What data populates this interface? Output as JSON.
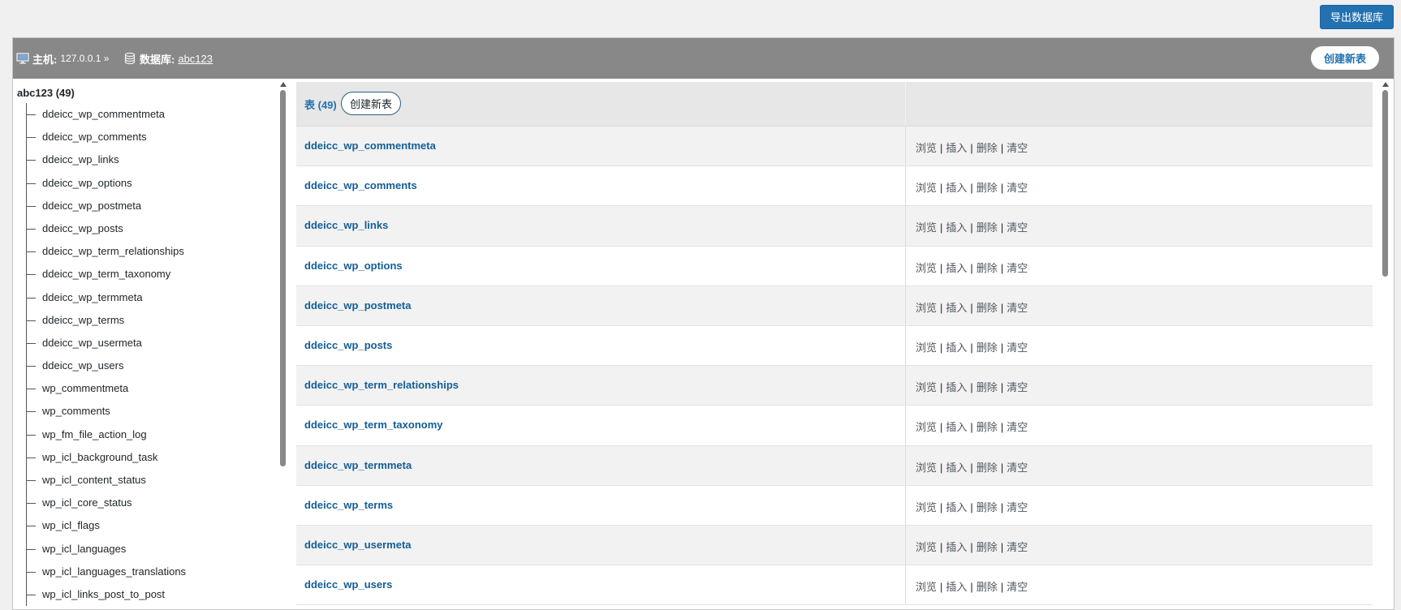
{
  "toolbar": {
    "export_label": "导出数据库"
  },
  "header": {
    "host_label": "主机:",
    "host_value": "127.0.0.1 »",
    "db_label": "数据库:",
    "db_value": "abc123",
    "create_table_label": "创建新表"
  },
  "tree": {
    "root_label": "abc123 (49)",
    "items": [
      "ddeicc_wp_commentmeta",
      "ddeicc_wp_comments",
      "ddeicc_wp_links",
      "ddeicc_wp_options",
      "ddeicc_wp_postmeta",
      "ddeicc_wp_posts",
      "ddeicc_wp_term_relationships",
      "ddeicc_wp_term_taxonomy",
      "ddeicc_wp_termmeta",
      "ddeicc_wp_terms",
      "ddeicc_wp_usermeta",
      "ddeicc_wp_users",
      "wp_commentmeta",
      "wp_comments",
      "wp_fm_file_action_log",
      "wp_icl_background_task",
      "wp_icl_content_status",
      "wp_icl_core_status",
      "wp_icl_flags",
      "wp_icl_languages",
      "wp_icl_languages_translations",
      "wp_icl_links_post_to_post"
    ]
  },
  "table": {
    "count_label": "表 (49)",
    "create_label": "创建新表",
    "actions": {
      "browse": "浏览",
      "insert": "插入",
      "delete": "删除",
      "empty": "清空",
      "sep": "|"
    },
    "rows": [
      "ddeicc_wp_commentmeta",
      "ddeicc_wp_comments",
      "ddeicc_wp_links",
      "ddeicc_wp_options",
      "ddeicc_wp_postmeta",
      "ddeicc_wp_posts",
      "ddeicc_wp_term_relationships",
      "ddeicc_wp_term_taxonomy",
      "ddeicc_wp_termmeta",
      "ddeicc_wp_terms",
      "ddeicc_wp_usermeta",
      "ddeicc_wp_users"
    ]
  },
  "colors": {
    "accent": "#2271b1",
    "header_bg": "#888888",
    "link": "#135e96"
  },
  "icons": {
    "host": "monitor-icon",
    "db": "database-icon"
  }
}
